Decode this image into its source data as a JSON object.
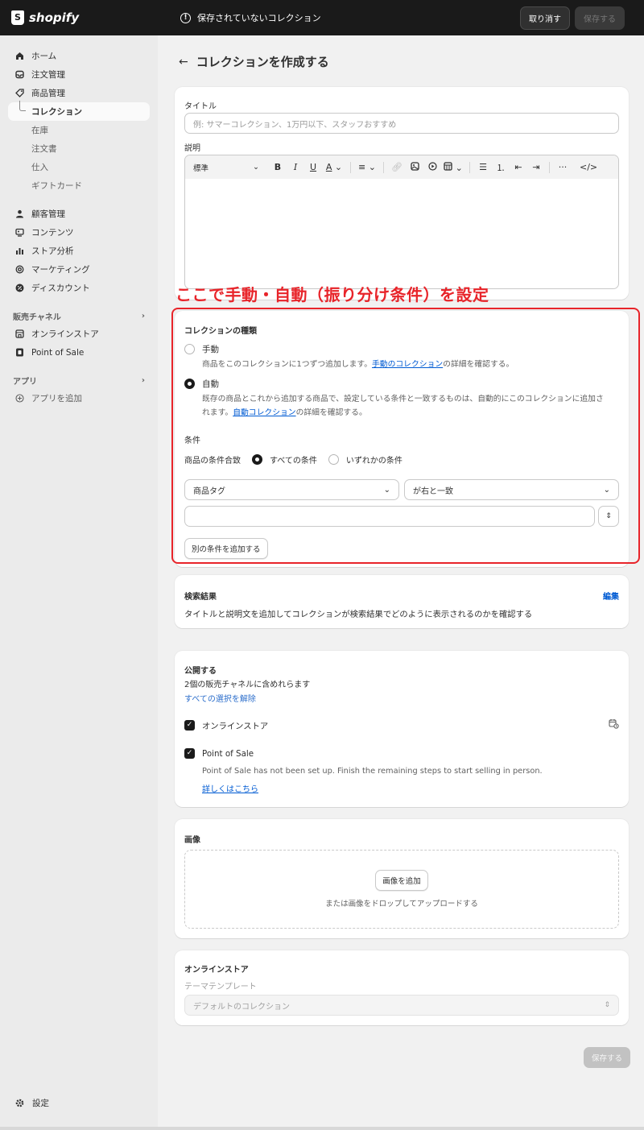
{
  "topbar": {
    "brand": "shopify",
    "unsaved_message": "保存されていないコレクション",
    "discard_label": "取り消す",
    "save_label": "保存する"
  },
  "sidebar": {
    "items": [
      {
        "label": "ホーム",
        "icon": "home-icon"
      },
      {
        "label": "注文管理",
        "icon": "inbox-icon"
      },
      {
        "label": "商品管理",
        "icon": "tag-icon"
      }
    ],
    "sub_items": [
      {
        "label": "コレクション",
        "active": true
      },
      {
        "label": "在庫"
      },
      {
        "label": "注文書"
      },
      {
        "label": "仕入"
      },
      {
        "label": "ギフトカード"
      }
    ],
    "items2": [
      {
        "label": "顧客管理",
        "icon": "person-icon"
      },
      {
        "label": "コンテンツ",
        "icon": "content-icon"
      },
      {
        "label": "ストア分析",
        "icon": "chart-icon"
      },
      {
        "label": "マーケティング",
        "icon": "target-icon"
      },
      {
        "label": "ディスカウント",
        "icon": "discount-icon"
      }
    ],
    "channels_heading": "販売チャネル",
    "channels": [
      {
        "label": "オンラインストア",
        "icon": "store-icon"
      },
      {
        "label": "Point of Sale",
        "icon": "pos-icon"
      }
    ],
    "apps_heading": "アプリ",
    "add_app": "アプリを追加",
    "settings": "設定"
  },
  "page": {
    "title": "コレクションを作成する"
  },
  "details_card": {
    "title_label": "タイトル",
    "title_placeholder": "例: サマーコレクション、1万円以下、スタッフおすすめ",
    "description_label": "説明",
    "format_select": "標準"
  },
  "annotation": {
    "text": "ここで手動・自動（振り分け条件）を設定",
    "color": "#e8242a"
  },
  "collection_type": {
    "heading": "コレクションの種類",
    "manual_label": "手動",
    "manual_help_pre": "商品をこのコレクションに1つずつ追加します。",
    "manual_help_link": "手動のコレクション",
    "manual_help_post": "の詳細を確認する。",
    "auto_label": "自動",
    "auto_help_line1": "既存の商品とこれから追加する商品で、設定している条件と一致するものは、自動的にこのコレクションに追加さ",
    "auto_help_line2_pre": "れます。",
    "auto_help_link": "自動コレクション",
    "auto_help_post": "の詳細を確認する。",
    "selected": "自動"
  },
  "conditions": {
    "heading": "条件",
    "match_label": "商品の条件合致",
    "all_label": "すべての条件",
    "any_label": "いずれかの条件",
    "field_select": "商品タグ",
    "operator_select": "が右と一致",
    "value": "",
    "add_button": "別の条件を追加する"
  },
  "seo_card": {
    "title": "検索結果",
    "edit_link": "編集",
    "description": "タイトルと説明文を追加してコレクションが検索結果でどのように表示されるのかを確認する"
  },
  "publish_card": {
    "title": "公開する",
    "channel_count": "2個の販売チャネルに含めれらます",
    "deselect_all": "すべての選択を解除",
    "channels": [
      {
        "label": "オンラインストア",
        "checked": true
      },
      {
        "label": "Point of Sale",
        "checked": true
      }
    ],
    "pos_notice": "Point of Sale has not been set up. Finish the remaining steps to start selling in person.",
    "learn_more": "詳しくはこちら"
  },
  "image_card": {
    "title": "画像",
    "add_button": "画像を追加",
    "drop_hint": "または画像をドロップしてアップロードする"
  },
  "store_card": {
    "title": "オンラインストア",
    "template_label": "テーマテンプレート",
    "template_value": "デフォルトのコレクション"
  },
  "footer": {
    "save_label": "保存する"
  }
}
